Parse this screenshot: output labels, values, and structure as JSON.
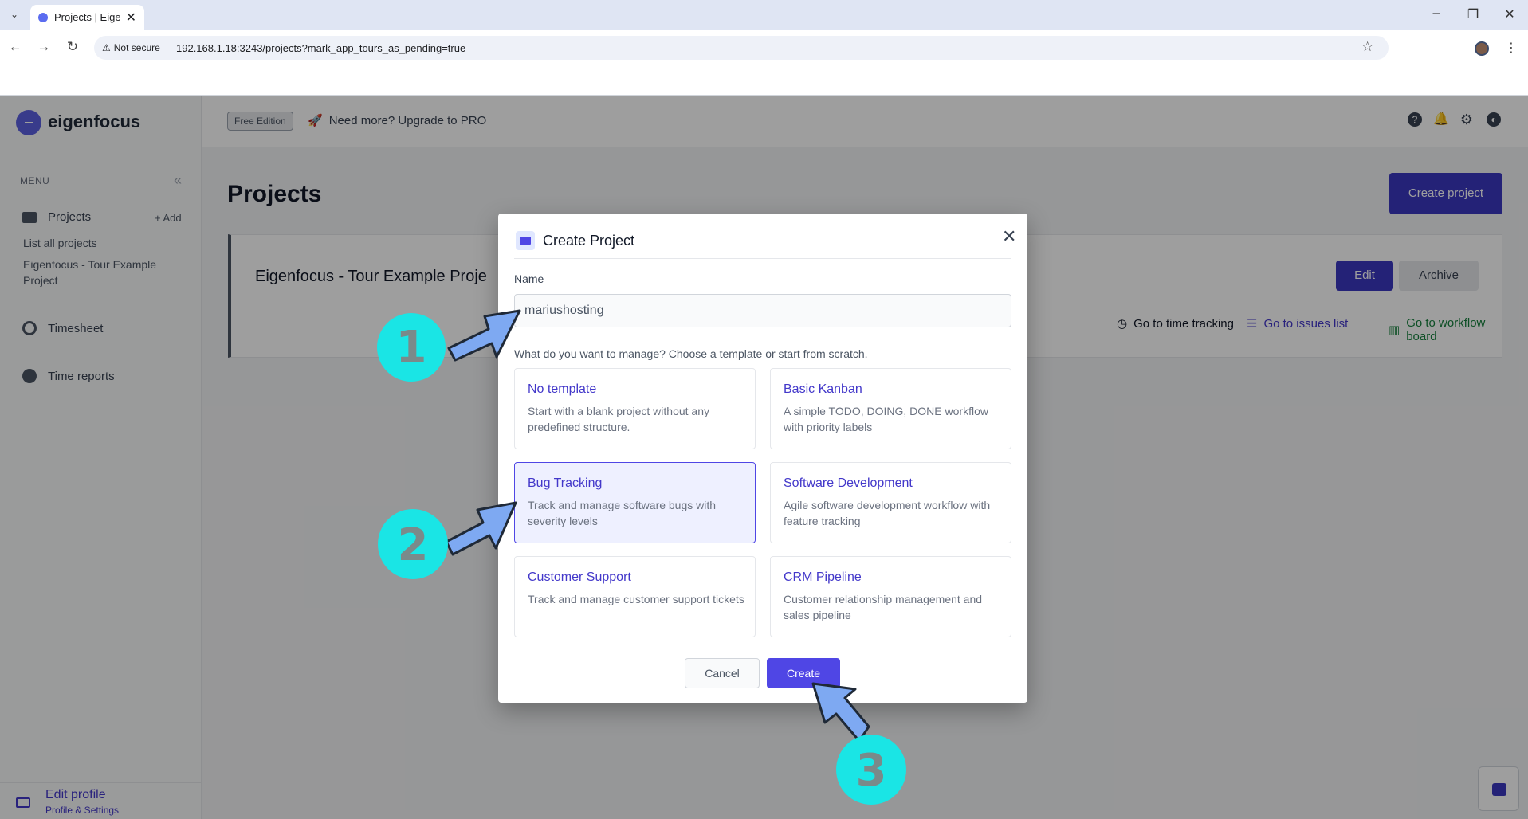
{
  "browser": {
    "tab_title": "Projects | Eigen",
    "not_secure": "Not secure",
    "url": "192.168.1.18:3243/projects?mark_app_tours_as_pending=true"
  },
  "app": {
    "logo_text": "eigenfocus",
    "menu_label": "MENU",
    "sidebar": {
      "projects": "Projects",
      "add": "Add",
      "list_all": "List all projects",
      "tour_project": "Eigenfocus - Tour Example Project",
      "timesheet": "Timesheet",
      "time_reports": "Time reports"
    },
    "edit_profile": {
      "title": "Edit profile",
      "subtitle": "Profile & Settings"
    },
    "topbar": {
      "badge": "Free Edition",
      "upgrade": "Need more? Upgrade to PRO"
    }
  },
  "main": {
    "title": "Projects",
    "create_button": "Create project",
    "project_card": {
      "name": "Eigenfocus - Tour Example Proje",
      "edit": "Edit",
      "archive": "Archive",
      "link_time": "Go to time tracking",
      "link_issues": "Go to issues list",
      "link_board": "Go to workflow board"
    }
  },
  "modal": {
    "title": "Create Project",
    "name_label": "Name",
    "name_value": "mariushosting",
    "manage_text": "What do you want to manage? Choose a template or start from scratch.",
    "templates": [
      {
        "title": "No template",
        "desc": "Start with a blank project without any predefined structure."
      },
      {
        "title": "Basic Kanban",
        "desc": "A simple TODO, DOING, DONE workflow with priority labels"
      },
      {
        "title": "Bug Tracking",
        "desc": "Track and manage software bugs with severity levels",
        "selected": true
      },
      {
        "title": "Software Development",
        "desc": "Agile software development workflow with feature tracking"
      },
      {
        "title": "Customer Support",
        "desc": "Track and manage customer support tickets"
      },
      {
        "title": "CRM Pipeline",
        "desc": "Customer relationship management and sales pipeline"
      }
    ],
    "cancel": "Cancel",
    "create": "Create"
  },
  "annotations": {
    "step1": "1",
    "step2": "2",
    "step3": "3"
  },
  "colors": {
    "accent": "#4f46e5",
    "annotation_circle": "#1ae5e5",
    "annotation_arrow": "#7ea9f2"
  }
}
